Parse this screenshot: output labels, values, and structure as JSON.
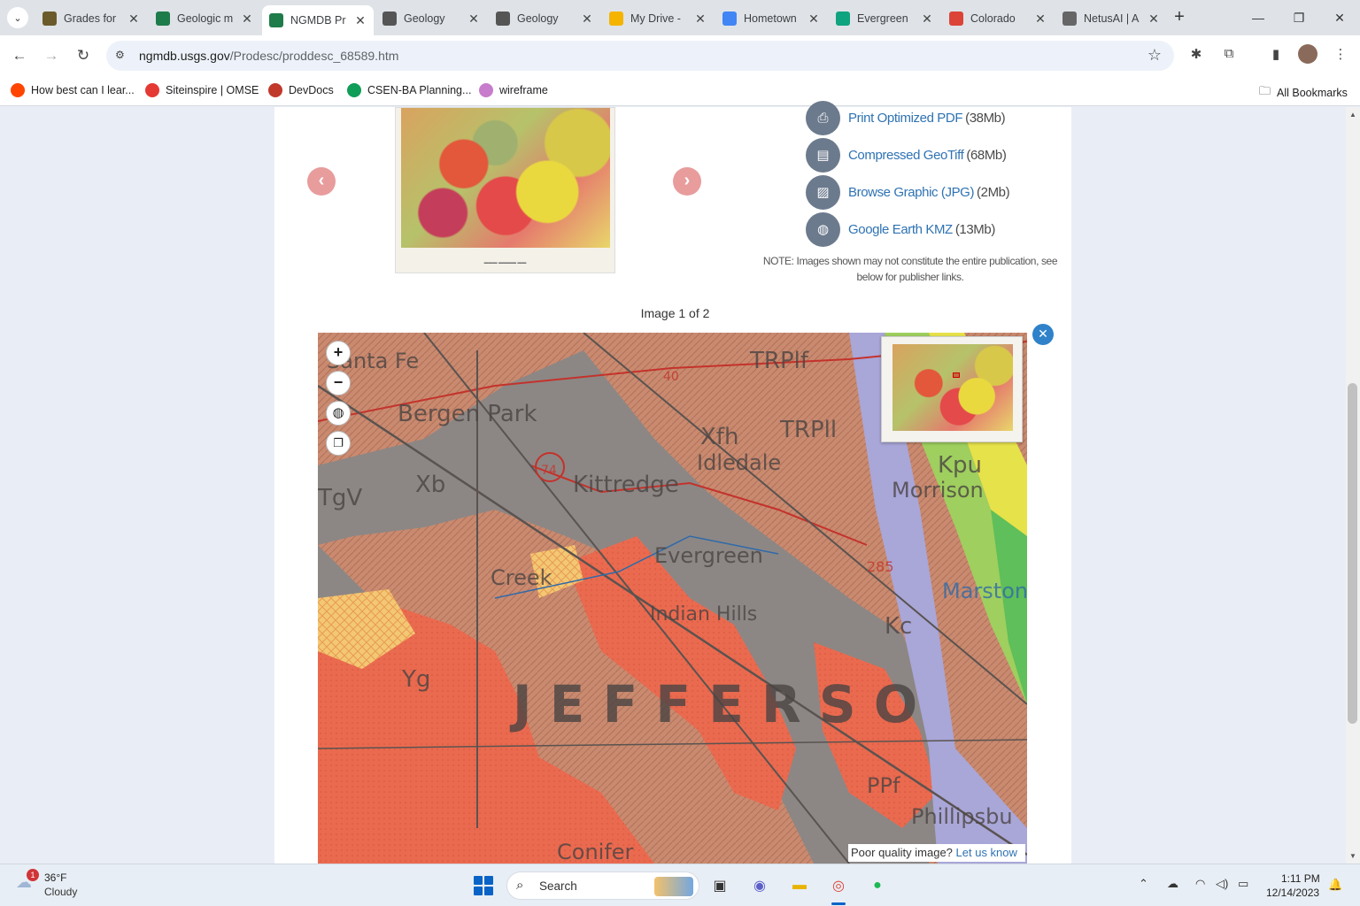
{
  "tabs": [
    {
      "title": "Grades for",
      "favicon": "cu-icon",
      "color": "#6b5a2a",
      "active": false
    },
    {
      "title": "Geologic m",
      "favicon": "usgs-icon",
      "color": "#1e7b4a",
      "active": false
    },
    {
      "title": "NGMDB Pr",
      "favicon": "usgs-icon",
      "color": "#1e7b4a",
      "active": true
    },
    {
      "title": "Geology",
      "favicon": "co-icon",
      "color": "#555555",
      "active": false
    },
    {
      "title": "Geology",
      "favicon": "co-icon",
      "color": "#555555",
      "active": false
    },
    {
      "title": "My Drive -",
      "favicon": "drive-icon",
      "color": "#f4b400",
      "active": false
    },
    {
      "title": "Hometown",
      "favicon": "docs-icon",
      "color": "#4285f4",
      "active": false
    },
    {
      "title": "Evergreen",
      "favicon": "chatgpt-icon",
      "color": "#10a37f",
      "active": false
    },
    {
      "title": "Colorado",
      "favicon": "chrome-icon",
      "color": "#db4437",
      "active": false
    },
    {
      "title": "NetusAI | A",
      "favicon": "globe-icon",
      "color": "#666666",
      "active": false
    }
  ],
  "address": {
    "host": "ngmdb.usgs.gov",
    "path": "/Prodesc/proddesc_68589.htm"
  },
  "bookmarks": [
    {
      "label": "How best can I lear...",
      "color": "#ff4500"
    },
    {
      "label": "Siteinspire | OMSE",
      "color": "#e53935"
    },
    {
      "label": "DevDocs",
      "color": "#c0392b"
    },
    {
      "label": "CSEN-BA Planning...",
      "color": "#0f9d58"
    },
    {
      "label": "wireframe",
      "color": "#c77dcc"
    }
  ],
  "all_bookmarks": "All Bookmarks",
  "downloads": [
    {
      "label": "Print Optimized PDF",
      "size": "(38Mb)",
      "icon": "pdf-icon"
    },
    {
      "label": "Compressed GeoTiff",
      "size": "(68Mb)",
      "icon": "file-icon"
    },
    {
      "label": "Browse Graphic (JPG)",
      "size": "(2Mb)",
      "icon": "image-file-icon"
    },
    {
      "label": "Google Earth KMZ",
      "size": "(13Mb)",
      "icon": "globe-icon"
    }
  ],
  "note": "NOTE: Images shown may not constitute the entire publication, see below for publisher links.",
  "image_caption": "Image 1 of 2",
  "map_labels": [
    "Santa Fe",
    "Bergen Park",
    "Xfh",
    "TRPlf",
    "TRPll",
    "Idledale",
    "Kpu",
    "Morrison",
    "Xb",
    "Kittredge",
    "TgV",
    "74",
    "40",
    "Evergreen",
    "285",
    "Marston",
    "Kc",
    "Indian Hills",
    "Yg",
    "J E F F E R S O",
    "PPf",
    "Conifer",
    "Phillipsbu",
    "Creek"
  ],
  "poor_quality": {
    "text": "Poor quality image?",
    "link": "Let us know"
  },
  "taskbar": {
    "weather_temp": "36°F",
    "weather_cond": "Cloudy",
    "weather_badge": "1",
    "search": "Search",
    "time": "1:11 PM",
    "date": "12/14/2023"
  }
}
